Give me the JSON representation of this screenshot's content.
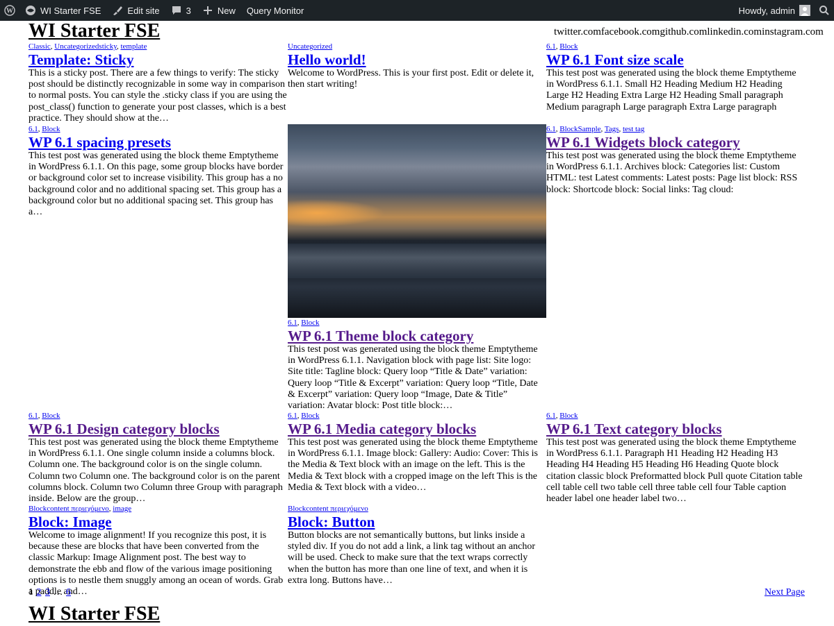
{
  "admin_bar": {
    "site_name": "WI Starter FSE",
    "edit_site": "Edit site",
    "comments_count": "3",
    "new": "New",
    "query_monitor": "Query Monitor",
    "howdy": "Howdy, admin"
  },
  "site": {
    "title": "WI Starter FSE",
    "social": "twitter.comfacebook.comgithub.comlinkedin.cominstagram.com"
  },
  "posts": [
    {
      "cats": [
        "Classic",
        "Uncategorizedsticky",
        "template"
      ],
      "title": "Template: Sticky",
      "excerpt": "This is a sticky post. There are a few things to verify: The sticky post should be distinctly recognizable in some way in comparison to normal posts. You can style the .sticky class if you are using the post_class() function to generate your post classes, which is a best practice. They should show at the…"
    },
    {
      "cats": [
        "Uncategorized"
      ],
      "title": "Hello world!",
      "excerpt": "Welcome to WordPress. This is your first post. Edit or delete it, then start writing!"
    },
    {
      "cats": [
        "6.1",
        "Block"
      ],
      "title": "WP 6.1 Font size scale",
      "excerpt": "This test post was generated using the block theme Emptytheme in WordPress 6.1.1. Small H2 Heading Medium H2 Heading Large H2 Heading Extra Large H2 Heading Small paragraph Medium paragraph Large paragraph Extra Large paragraph"
    },
    {
      "cats": [
        "6.1",
        "Block"
      ],
      "title": "WP 6.1 spacing presets",
      "excerpt": "This test post was generated using the block theme Emptytheme in WordPress 6.1.1. On this page, some group blocks have border or background color set to increase visibility. This group has a no background color and no additional spacing set. This group has a background color but no additional spacing set. This group has a…"
    },
    {
      "cats": [
        "6.1",
        "BlockSample",
        "Tags",
        "test tag"
      ],
      "title": "WP 6.1 Widgets block category",
      "excerpt": "This test post was generated using the block theme Emptytheme in WordPress 6.1.1. Archives block: Categories list: Custom HTML: test Latest comments: Latest posts: Page list block: RSS block: Shortcode block: Social links: Tag cloud:"
    },
    {
      "cats": [
        "6.1",
        "Block"
      ],
      "title": "WP 6.1 Theme block category",
      "excerpt": "This test post was generated using the block theme Emptytheme in WordPress 6.1.1. Navigation block with page list: Site logo: Site title: Tagline block: Query loop “Title & Date” variation: Query loop “Title & Excerpt” variation: Query loop “Title, Date & Excerpt” variation: Query loop “Image, Date & Title” variation: Avatar block: Post title block:…"
    },
    {
      "cats": [
        "6.1",
        "Block"
      ],
      "title": "WP 6.1 Design category blocks",
      "excerpt": "This test post was generated using the block theme Emptytheme in WordPress 6.1.1. One single column inside a columns block. Column one. The background color is on the single column. Column two Column one. The background color is on the parent columns block. Column two Column three Group with paragraph inside. Below are the group…"
    },
    {
      "cats": [
        "6.1",
        "Block"
      ],
      "title": "WP 6.1 Media category blocks",
      "excerpt": "This test post was generated using the block theme Emptytheme in WordPress 6.1.1. Image block: Gallery: Audio: Cover: This is the Media & Text block with an image on the left. This is the Media & Text block with a cropped image on the left This is the Media & Text block with a video…"
    },
    {
      "cats": [
        "6.1",
        "Block"
      ],
      "title": "WP 6.1 Text category blocks",
      "excerpt": "This test post was generated using the block theme Emptytheme in WordPress 6.1.1. Paragraph H1 Heading H2 Heading H3 Heading H4 Heading H5 Heading H6 Heading Quote block citation classic block Preformatted block Pull quote Citation table cell table cell two table cell three table cell four Table caption header label one header label two…"
    },
    {
      "cats": [
        "Blockcontent περιεχόμενο",
        "image"
      ],
      "title": "Block: Image",
      "excerpt": "Welcome to image alignment! If you recognize this post, it is because these are blocks that have been converted from the classic Markup: Image Alignment post. The best way to demonstrate the ebb and flow of the various image positioning options is to nestle them snuggly among an ocean of words. Grab a paddle and…"
    },
    {
      "cats": [
        "Blockcontent περιεχόμενο"
      ],
      "title": "Block: Button",
      "excerpt": "Button blocks are not semantically buttons, but links inside a styled div.  If you do not add a link, a link tag without an anchor will be used. Check to make sure that the text wraps correctly when the button has more than one line of text, and when it is extra long. Buttons have…"
    }
  ],
  "pagination": {
    "current": "1",
    "p2": "2",
    "p3": "3",
    "dots": "…",
    "last": "6",
    "next": "Next Page"
  },
  "footer": {
    "title": "WI Starter FSE"
  },
  "colors": {
    "admin_bar_bg": "#1d2327",
    "link": "#0000ee",
    "visited": "#551a8b"
  }
}
